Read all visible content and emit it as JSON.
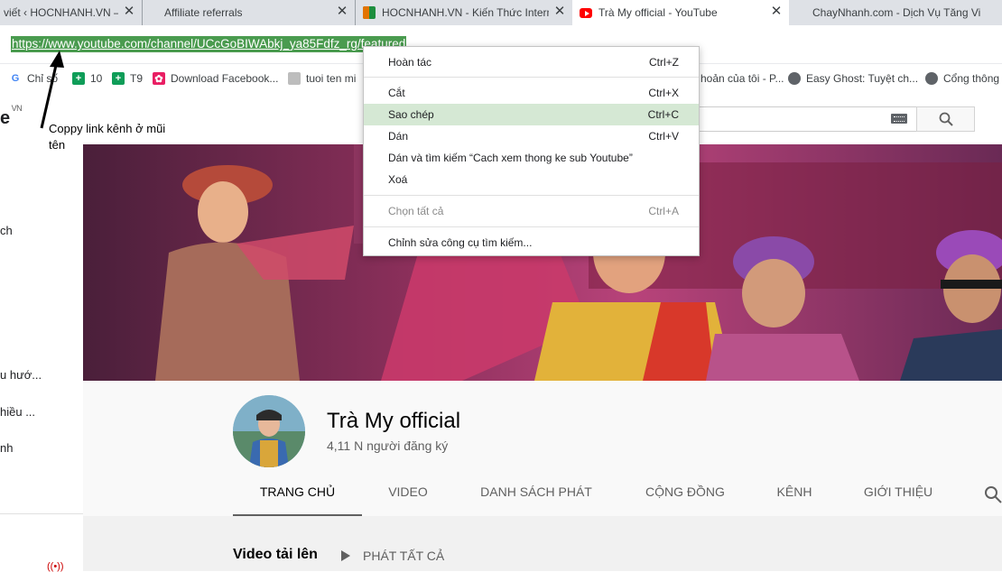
{
  "browser": {
    "tabs": [
      {
        "title": "viết ‹ HOCNHANH.VN —",
        "active": false
      },
      {
        "title": "Affiliate referrals",
        "active": false
      },
      {
        "title": "HOCNHANH.VN - Kiến Thức Internet",
        "active": false
      },
      {
        "title": "Trà My official - YouTube",
        "active": true
      },
      {
        "title": "ChayNhanh.com - Dịch Vụ Tăng Vi",
        "active": false
      }
    ],
    "close_glyph": "✕",
    "url": "https://www.youtube.com/channel/UCcGoBIWAbkj_ya85Fdfz_rg/featured",
    "bookmarks": [
      {
        "label": "Chỉ số",
        "icon": "google-icon"
      },
      {
        "label": "10",
        "icon": "plus-icon"
      },
      {
        "label": "T9",
        "icon": "plus-icon"
      },
      {
        "label": "Download Facebook...",
        "icon": "image-icon"
      },
      {
        "label": "tuoi ten mi",
        "icon": "doc-icon"
      },
      {
        "label": "hoản của tôi - P...",
        "icon": "none"
      },
      {
        "label": "Easy Ghost: Tuyệt ch...",
        "icon": "globe-icon"
      },
      {
        "label": "Cổng thông",
        "icon": "globe-icon"
      }
    ]
  },
  "youtube": {
    "logo_fragment": "e",
    "logo_region": "VN",
    "sidebar_fragments": [
      "ch",
      "u hướ...",
      "hiều ...",
      "nh"
    ],
    "channel": {
      "name": "Trà My official",
      "subscribers": "4,11 N người đăng ký"
    },
    "channel_tabs": [
      "TRANG CHỦ",
      "VIDEO",
      "DANH SÁCH PHÁT",
      "CỘNG ĐỒNG",
      "KÊNH",
      "GIỚI THIỆU"
    ],
    "active_tab": "TRANG CHỦ",
    "uploads": {
      "title": "Video tải lên",
      "play_all": "PHÁT TẤT CẢ"
    }
  },
  "annotation": {
    "text": "Coppy link kênh ở mũi tên"
  },
  "context_menu": {
    "items": [
      {
        "label": "Hoàn tác",
        "shortcut": "Ctrl+Z",
        "highlighted": false,
        "disabled": false
      },
      {
        "label": "Cắt",
        "shortcut": "Ctrl+X",
        "highlighted": false,
        "disabled": false
      },
      {
        "label": "Sao chép",
        "shortcut": "Ctrl+C",
        "highlighted": true,
        "disabled": false
      },
      {
        "label": "Dán",
        "shortcut": "Ctrl+V",
        "highlighted": false,
        "disabled": false
      },
      {
        "label": "Dán và tìm kiếm “Cach xem thong ke sub Youtube”",
        "shortcut": "",
        "highlighted": false,
        "disabled": false
      },
      {
        "label": "Xoá",
        "shortcut": "",
        "highlighted": false,
        "disabled": false
      },
      {
        "label": "Chọn tất cả",
        "shortcut": "Ctrl+A",
        "highlighted": false,
        "disabled": true
      },
      {
        "label": "Chỉnh sửa công cụ tìm kiếm...",
        "shortcut": "",
        "highlighted": false,
        "disabled": false
      }
    ]
  },
  "colors": {
    "url_selection": "#4a9b4f",
    "menu_highlight": "#d5e8d4",
    "youtube_red": "#ff0000"
  }
}
